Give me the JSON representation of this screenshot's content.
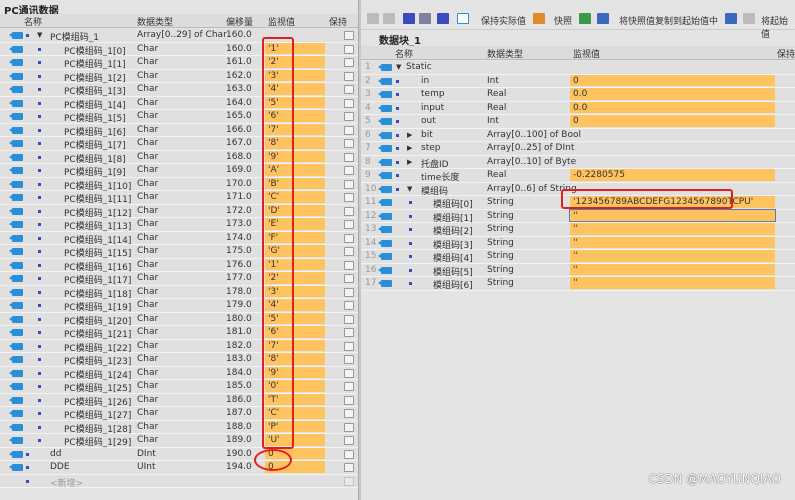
{
  "left": {
    "title": "PC通讯数据",
    "columns": [
      "名称",
      "数据类型",
      "偏移量",
      "监视值",
      "保持"
    ],
    "parent": {
      "name": "PC模组码_1",
      "type": "Array[0..29] of Char",
      "offset": "160.0"
    },
    "element_prefix": "PC模组码_1",
    "element_type": "Char",
    "elements": [
      "'1'",
      "'2'",
      "'3'",
      "'4'",
      "'5'",
      "'6'",
      "'7'",
      "'8'",
      "'9'",
      "'A'",
      "'B'",
      "'C'",
      "'D'",
      "'E'",
      "'F'",
      "'G'",
      "'1'",
      "'2'",
      "'3'",
      "'4'",
      "'5'",
      "'6'",
      "'7'",
      "'8'",
      "'9'",
      "'0'",
      "'T'",
      "'C'",
      "'P'",
      "'U'"
    ],
    "offsets": [
      "160.0",
      "161.0",
      "162.0",
      "163.0",
      "164.0",
      "165.0",
      "166.0",
      "167.0",
      "168.0",
      "169.0",
      "170.0",
      "171.0",
      "172.0",
      "173.0",
      "174.0",
      "175.0",
      "176.0",
      "177.0",
      "178.0",
      "179.0",
      "180.0",
      "181.0",
      "182.0",
      "183.0",
      "184.0",
      "185.0",
      "186.0",
      "187.0",
      "188.0",
      "189.0"
    ],
    "extra": [
      {
        "name": "dd",
        "type": "DInt",
        "offset": "190.0",
        "value": "0"
      },
      {
        "name": "DDE",
        "type": "UInt",
        "offset": "194.0",
        "value": "0"
      }
    ],
    "add_new": "<新增>"
  },
  "right": {
    "toolbar": {
      "keep_actual": "保持实际值",
      "snapshot": "快照",
      "copy_snapshot": "将快照值复制到起始值中",
      "load_start": "将起始值"
    },
    "title": "数据块_1",
    "columns": [
      "名称",
      "数据类型",
      "监视值",
      "保持"
    ],
    "rows": [
      {
        "n": "1",
        "name": "Static",
        "type": "",
        "value": "",
        "level": 0,
        "expand": "down"
      },
      {
        "n": "2",
        "name": "in",
        "type": "Int",
        "value": "0",
        "level": 1
      },
      {
        "n": "3",
        "name": "temp",
        "type": "Real",
        "value": "0.0",
        "level": 1
      },
      {
        "n": "4",
        "name": "input",
        "type": "Real",
        "value": "0.0",
        "level": 1
      },
      {
        "n": "5",
        "name": "out",
        "type": "Int",
        "value": "0",
        "level": 1
      },
      {
        "n": "6",
        "name": "bit",
        "type": "Array[0..100] of Bool",
        "value": "",
        "level": 1,
        "expand": "right"
      },
      {
        "n": "7",
        "name": "step",
        "type": "Array[0..25] of DInt",
        "value": "",
        "level": 1,
        "expand": "right"
      },
      {
        "n": "8",
        "name": "托盘ID",
        "type": "Array[0..10] of Byte",
        "value": "",
        "level": 1,
        "expand": "right"
      },
      {
        "n": "9",
        "name": "time长度",
        "type": "Real",
        "value": "-0.2280575",
        "level": 1
      },
      {
        "n": "10",
        "name": "模组码",
        "type": "Array[0..6] of String",
        "value": "",
        "level": 1,
        "expand": "down"
      },
      {
        "n": "11",
        "name": "模组码[0]",
        "type": "String",
        "value": "'123456789ABCDEFG1234567890TCPU'",
        "level": 2
      },
      {
        "n": "12",
        "name": "模组码[1]",
        "type": "String",
        "value": "''",
        "level": 2
      },
      {
        "n": "13",
        "name": "模组码[2]",
        "type": "String",
        "value": "''",
        "level": 2
      },
      {
        "n": "14",
        "name": "模组码[3]",
        "type": "String",
        "value": "''",
        "level": 2
      },
      {
        "n": "15",
        "name": "模组码[4]",
        "type": "String",
        "value": "''",
        "level": 2
      },
      {
        "n": "16",
        "name": "模组码[5]",
        "type": "String",
        "value": "''",
        "level": 2
      },
      {
        "n": "17",
        "name": "模组码[6]",
        "type": "String",
        "value": "''",
        "level": 2
      }
    ]
  },
  "watermark": "CSDN @MAOYUNQIAO",
  "colors": {
    "monitor": "#fec35f",
    "highlight": "#e02020",
    "icon": "#2a8fd6"
  }
}
